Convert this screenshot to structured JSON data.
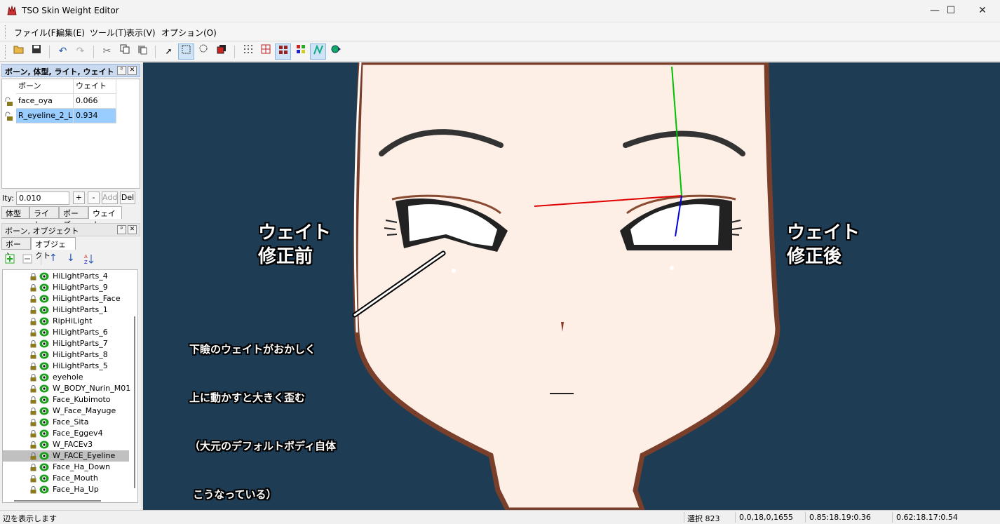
{
  "window": {
    "title": "TSO Skin Weight Editor",
    "minimize": "—",
    "maximize": "☐",
    "close": "✕"
  },
  "menu": [
    "ファイル(F)",
    "編集(E)",
    "ツール(T)",
    "表示(V)",
    "オプション(O)"
  ],
  "panel1": {
    "title": "ボーン, 体型, ライト, ウェイト",
    "pin": "ᵖ",
    "close": "✕",
    "headers": [
      "ボーン",
      "ウェイト"
    ],
    "rows": [
      {
        "bone": "face_oya",
        "weight": "0.066"
      },
      {
        "bone": "R_eyeline_2_L",
        "weight": "0.934"
      }
    ],
    "ity_label": "Ity:",
    "ity_value": "0.010",
    "plus": "+",
    "minus": "-",
    "add": "Add",
    "del": "Del",
    "tabs": [
      "体型",
      "ライト",
      "ポーズ",
      "ウェイト"
    ]
  },
  "panel2": {
    "title": "ボーン, オブジェクト",
    "pin": "ᵖ",
    "close": "✕",
    "tabs": [
      "ボーン",
      "オブジェクト"
    ],
    "objects": [
      "HiLightParts_4",
      "HiLightParts_9",
      "HiLightParts_Face",
      "HiLightParts_1",
      "RipHiLight",
      "HiLightParts_6",
      "HiLightParts_7",
      "HiLightParts_8",
      "HiLightParts_5",
      "eyehole",
      "W_BODY_Nurin_M01",
      "Face_Kubimoto",
      "W_Face_Mayuge",
      "Face_Sita",
      "Face_Eggev4",
      "W_FACEv3",
      "W_FACE_Eyeline",
      "Face_Ha_Down",
      "Face_Mouth",
      "Face_Ha_Up"
    ],
    "selected_object": "W_FACE_Eyeline"
  },
  "viewport": {
    "before_label": [
      "ウェイト",
      "修正前"
    ],
    "after_label": [
      "ウェイト",
      "修正後"
    ],
    "note": [
      "下瞼のウェイトがおかしく",
      "上に動かすと大きく歪む",
      "（大元のデフォルトボディ自体",
      " こうなっている）"
    ],
    "colors": {
      "background": "#1f3c55",
      "skin": "#fdeee6",
      "outline": "#7a3f2a"
    }
  },
  "status": {
    "message": "辺を表示します",
    "selection": "選択 823",
    "coords": "0,0,18,0,1655",
    "t1": "0.85:18.19:0.36",
    "t2": "0.62:18.17:0.54"
  }
}
